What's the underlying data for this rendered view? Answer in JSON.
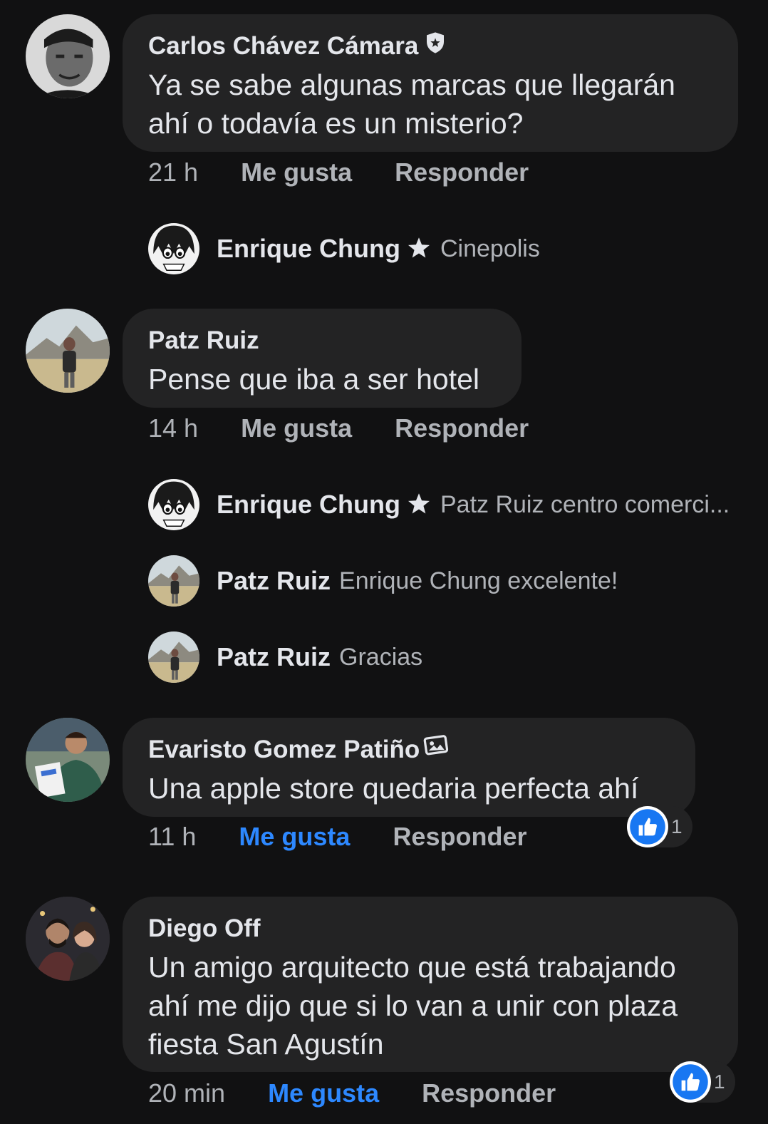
{
  "comments": [
    {
      "author": "Carlos Chávez Cámara",
      "badge_icon": "shield-icon",
      "text": "Ya se sabe algunas marcas que llegarán ahí o todavía es un misterio?",
      "time": "21 h",
      "like_label": "Me gusta",
      "reply_label": "Responder",
      "liked": false,
      "replies": [
        {
          "author": "Enrique Chung",
          "badge_icon": "star-badge-icon",
          "text": "Cinepolis"
        }
      ]
    },
    {
      "author": "Patz Ruiz",
      "text": "Pense que iba a ser hotel",
      "time": "14 h",
      "like_label": "Me gusta",
      "reply_label": "Responder",
      "liked": false,
      "replies": [
        {
          "author": "Enrique Chung",
          "badge_icon": "star-badge-icon",
          "text": "Patz Ruiz centro comerci..."
        },
        {
          "author": "Patz Ruiz",
          "text": "Enrique Chung excelente!"
        },
        {
          "author": "Patz Ruiz",
          "text": "Gracias"
        }
      ]
    },
    {
      "author": "Evaristo Gomez Patiño",
      "badge_icon": "photo-badge-icon",
      "text": "Una apple store quedaria perfecta ahí",
      "time": "11 h",
      "like_label": "Me gusta",
      "reply_label": "Responder",
      "liked": true,
      "reaction_count": "1"
    },
    {
      "author": "Diego Off",
      "text": "Un amigo arquitecto que está trabajando ahí me dijo que si lo van a unir con plaza fiesta San Agustín",
      "time": "20 min",
      "like_label": "Me gusta",
      "reply_label": "Responder",
      "liked": true,
      "reaction_count": "1"
    }
  ],
  "colors": {
    "background": "#111112",
    "bubble": "#232324",
    "text_primary": "#e4e6eb",
    "text_secondary": "#b0b3b8",
    "liked_blue": "#2d88ff"
  }
}
